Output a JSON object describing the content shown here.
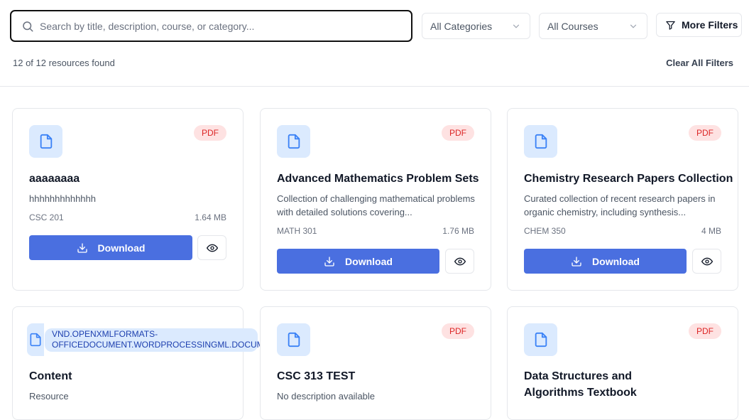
{
  "search": {
    "placeholder": "Search by title, description, course, or category..."
  },
  "filters": {
    "category": "All Categories",
    "course": "All Courses",
    "more_label": "More Filters"
  },
  "results": {
    "count_text": "12 of 12 resources found",
    "clear_label": "Clear All Filters"
  },
  "cards": [
    {
      "type": "PDF",
      "title": "aaaaaaaa",
      "description": "hhhhhhhhhhhhh",
      "course": "CSC 201",
      "size": "1.64 MB",
      "download": "Download"
    },
    {
      "type": "PDF",
      "title": "Advanced Mathematics Problem Sets",
      "description": "Collection of challenging mathematical problems with detailed solutions covering...",
      "course": "MATH 301",
      "size": "1.76 MB",
      "download": "Download"
    },
    {
      "type": "PDF",
      "title": "Chemistry Research Papers Collection",
      "description": "Curated collection of recent research papers in organic chemistry, including synthesis...",
      "course": "CHEM 350",
      "size": "4 MB",
      "download": "Download"
    },
    {
      "type": "VND.OPENXMLFORMATS-OFFICEDOCUMENT.WORDPROCESSINGML.DOCUMENT",
      "title": "Content",
      "description": "Resource"
    },
    {
      "type": "PDF",
      "title": "CSC 313 TEST",
      "description": "No description available"
    },
    {
      "type": "PDF",
      "title": "Data Structures and Algorithms Textbook"
    }
  ],
  "colors": {
    "accent": "#4a6fe0",
    "badge_bg": "#fee2e2",
    "badge_text": "#dc2626",
    "icon_bg": "#dbeafe"
  }
}
